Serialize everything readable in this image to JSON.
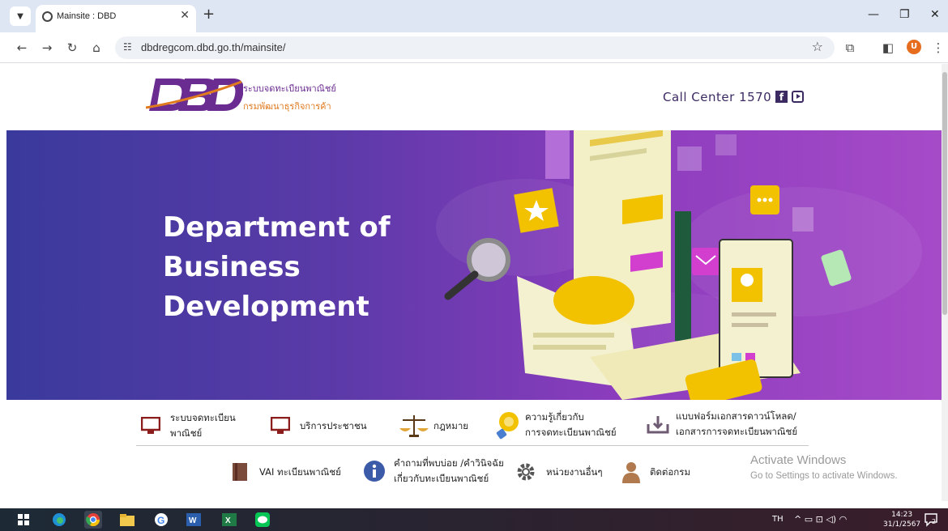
{
  "browser": {
    "tab_title": "Mainsite : DBD",
    "new_tab_label": "+",
    "url": "dbdregcom.dbd.go.th/mainsite/",
    "profile_initial": "U"
  },
  "header": {
    "logo_th_line1": "ระบบจดทะเบียนพาณิชย์",
    "logo_th_line2": "กรมพัฒนาธุรกิจการค้า",
    "call_center": "Call Center 1570 /"
  },
  "hero": {
    "title_line1": "Department of",
    "title_line2": "Business",
    "title_line3": "Development"
  },
  "menu_row1": [
    {
      "line1": "ระบบจดทะเบียน",
      "line2": "พาณิชย์",
      "icon": "monitor-icon"
    },
    {
      "line1": "บริการประชาชน",
      "line2": "",
      "icon": "monitor-icon"
    },
    {
      "line1": "กฎหมาย",
      "line2": "",
      "icon": "scales-icon"
    },
    {
      "line1": "ความรู้เกี่ยวกับ",
      "line2": "การจดทะเบียนพาณิชย์",
      "icon": "lightbulb-icon"
    },
    {
      "line1": "แบบฟอร์มเอกสารดาวน์โหลด/",
      "line2": "เอกสารการจดทะเบียนพาณิชย์",
      "icon": "download-icon"
    }
  ],
  "menu_row2": [
    {
      "line1": "VAI ทะเบียนพาณิชย์",
      "line2": "",
      "icon": "book-icon"
    },
    {
      "line1": "คำถามที่พบบ่อย /คำวินิจฉัย",
      "line2": "เกี่ยวกับทะเบียนพาณิชย์",
      "icon": "info-icon"
    },
    {
      "line1": "หน่วยงานอื่นๆ",
      "line2": "",
      "icon": "gear-icon"
    },
    {
      "line1": "ติดต่อกรม",
      "line2": "",
      "icon": "person-icon"
    }
  ],
  "watermark": {
    "line1": "Activate Windows",
    "line2": "Go to Settings to activate Windows."
  },
  "taskbar": {
    "language": "TH",
    "time": "14:23",
    "date": "31/1/2567",
    "notification_count": "2"
  },
  "colors": {
    "brand_purple": "#6b2c91",
    "brand_orange": "#e07a1f",
    "hero_start": "#3a3a9c",
    "hero_end": "#a64bc8"
  }
}
